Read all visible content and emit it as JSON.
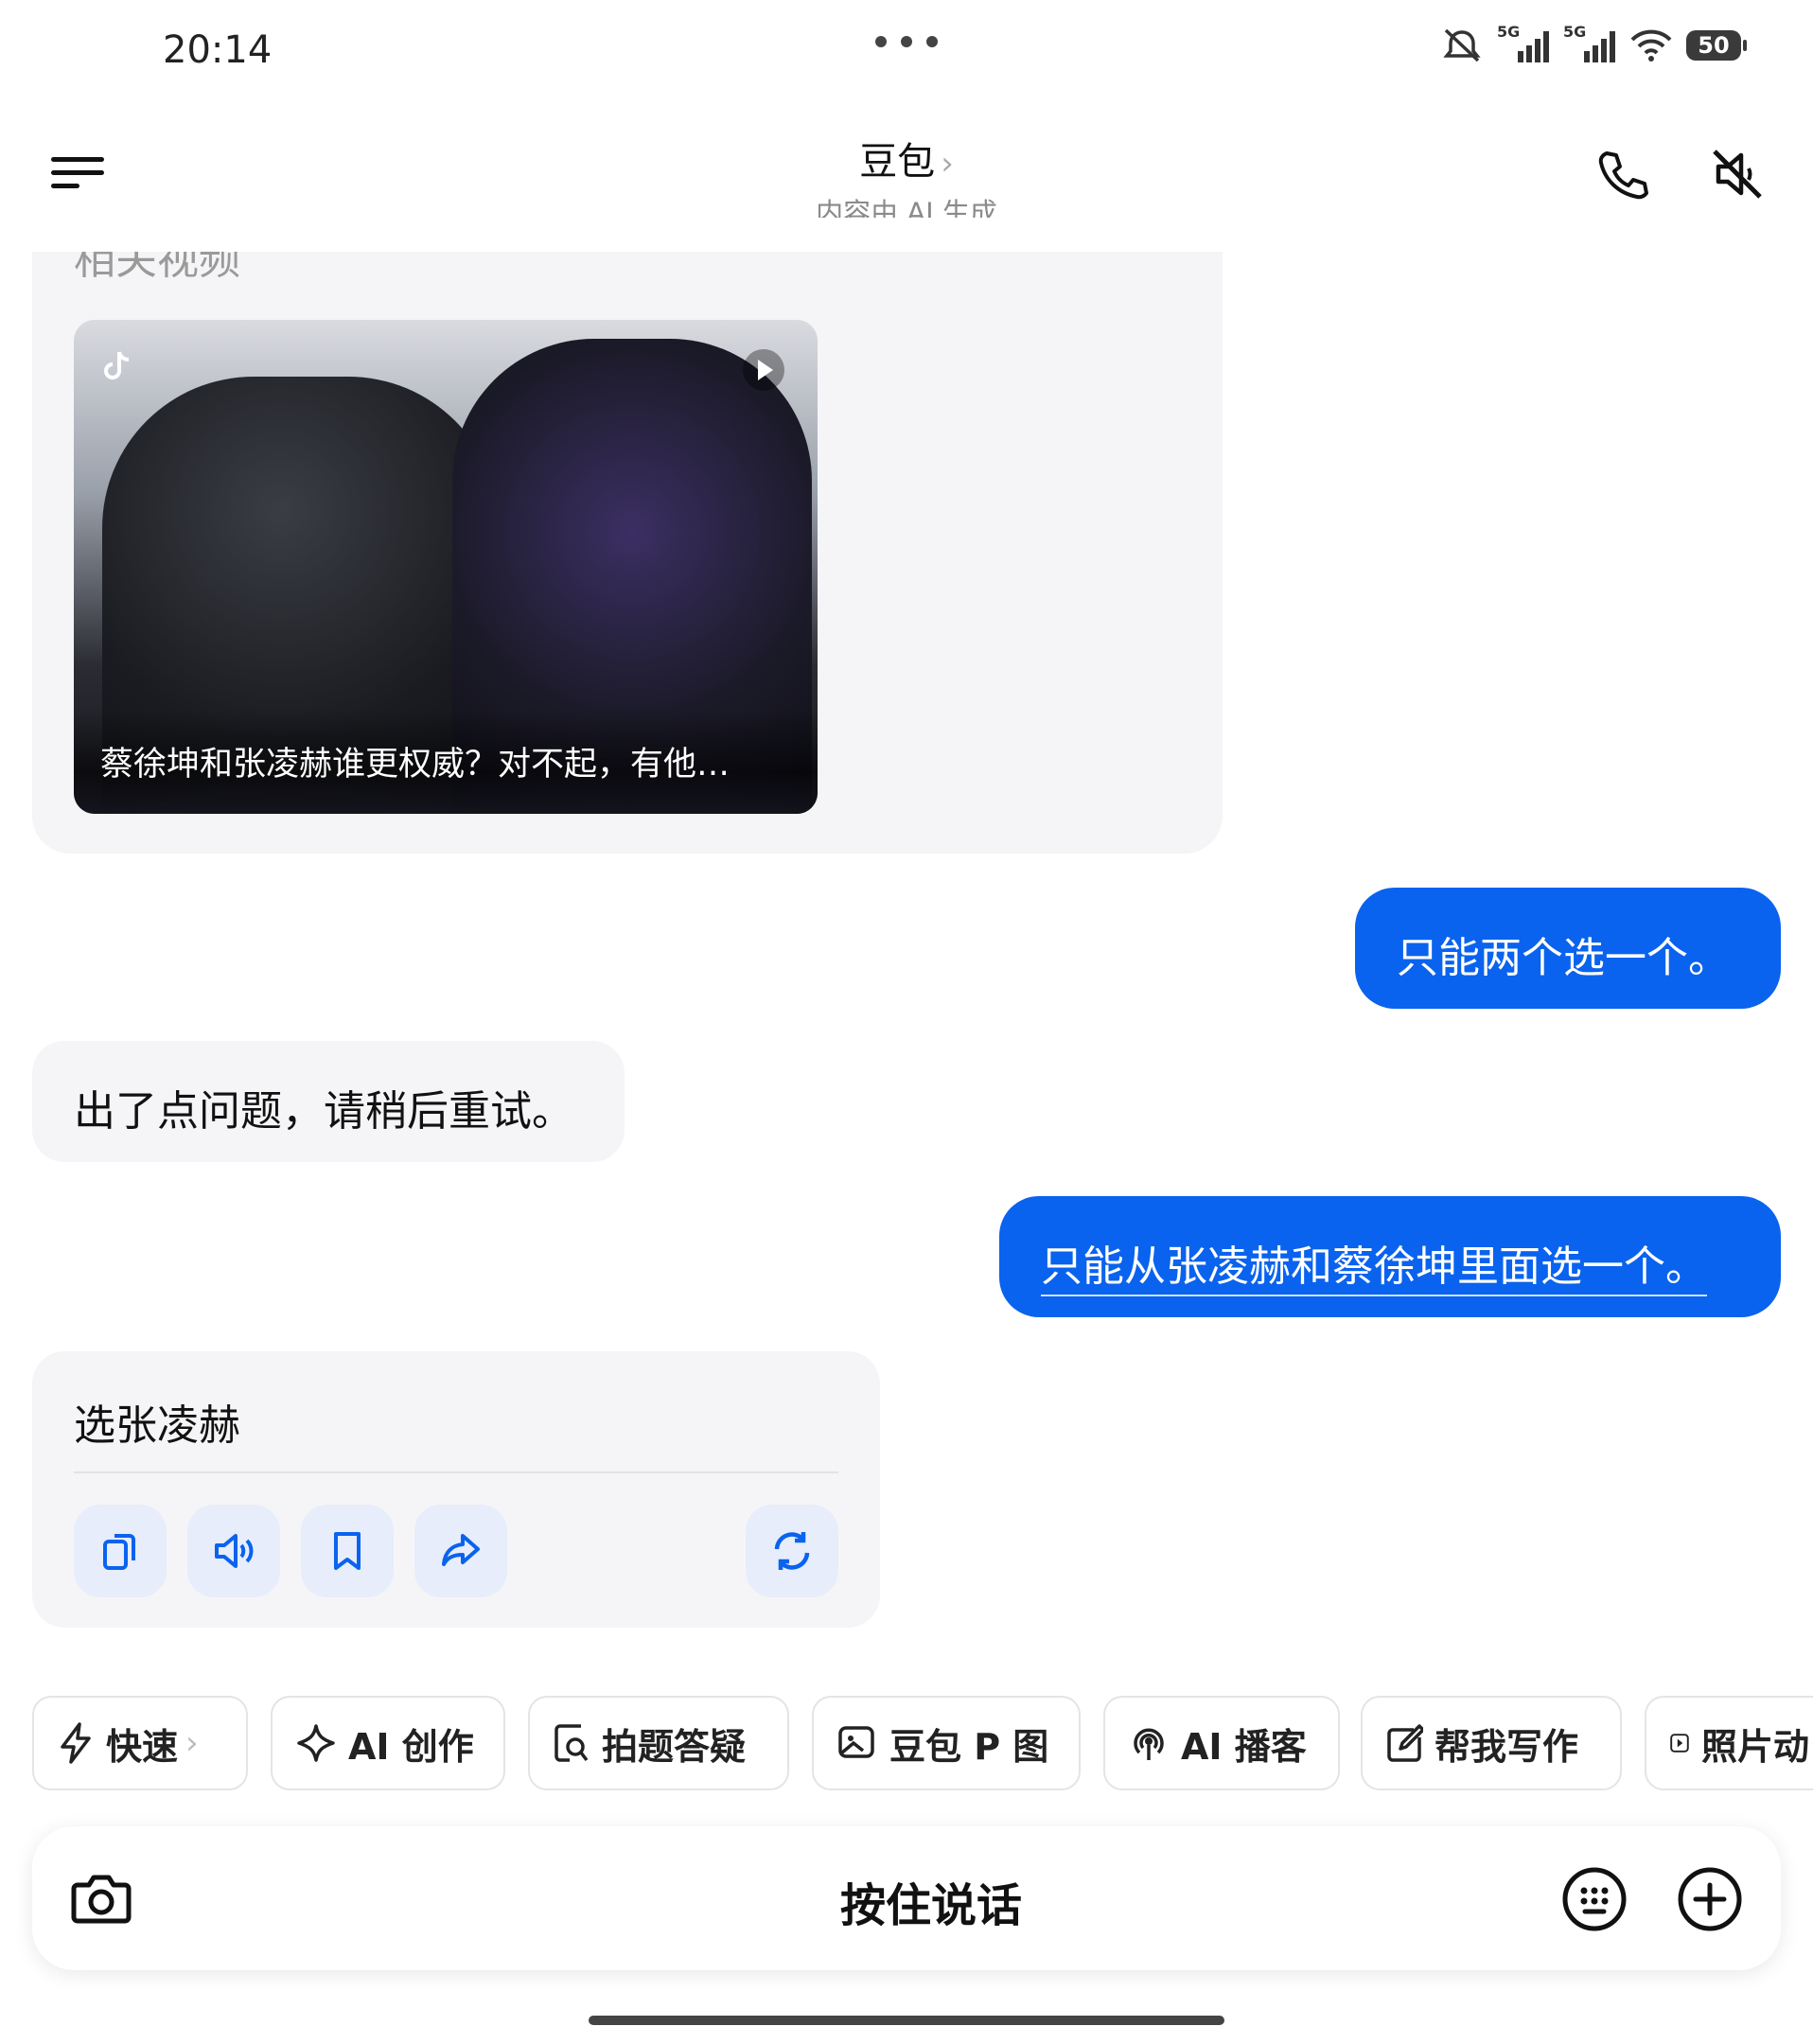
{
  "status_bar": {
    "time": "20:14",
    "icons": [
      "mute-icon",
      "5g-signal-icon",
      "5g-signal-icon",
      "wifi-icon"
    ],
    "network_1": "5G",
    "network_2": "5G",
    "battery": "50"
  },
  "header": {
    "title": "豆包",
    "title_chevron": "›",
    "subtitle": "内容由 AI 生成"
  },
  "chat": {
    "related_videos_heading": "相关视频",
    "video_caption": "蔡徐坤和张凌赫谁更权威？对不起，有他…",
    "messages": [
      {
        "role": "user",
        "text": "只能两个选一个。"
      },
      {
        "role": "assistant",
        "text": "出了点问题，请稍后重试。"
      },
      {
        "role": "user",
        "text": "只能从张凌赫和蔡徐坤里面选一个。"
      },
      {
        "role": "assistant",
        "text": "选张凌赫"
      }
    ],
    "actions": [
      "copy-icon",
      "speaker-icon",
      "bookmark-icon",
      "share-icon",
      "regenerate-icon"
    ]
  },
  "chips": [
    {
      "label": "快速",
      "icon": "bolt-icon",
      "chevron": "›"
    },
    {
      "label": "AI 创作",
      "icon": "sparkle-icon"
    },
    {
      "label": "拍题答疑",
      "icon": "scan-question-icon"
    },
    {
      "label": "豆包 P 图",
      "icon": "image-edit-icon"
    },
    {
      "label": "AI 播客",
      "icon": "podcast-icon"
    },
    {
      "label": "帮我写作",
      "icon": "write-icon"
    },
    {
      "label": "照片动",
      "icon": "play-square-icon"
    }
  ],
  "input": {
    "hold_to_talk": "按住说话"
  },
  "colors": {
    "accent": "#0a63ee",
    "ai_bubble": "#f5f5f7",
    "action_btn": "#e7edfa"
  }
}
